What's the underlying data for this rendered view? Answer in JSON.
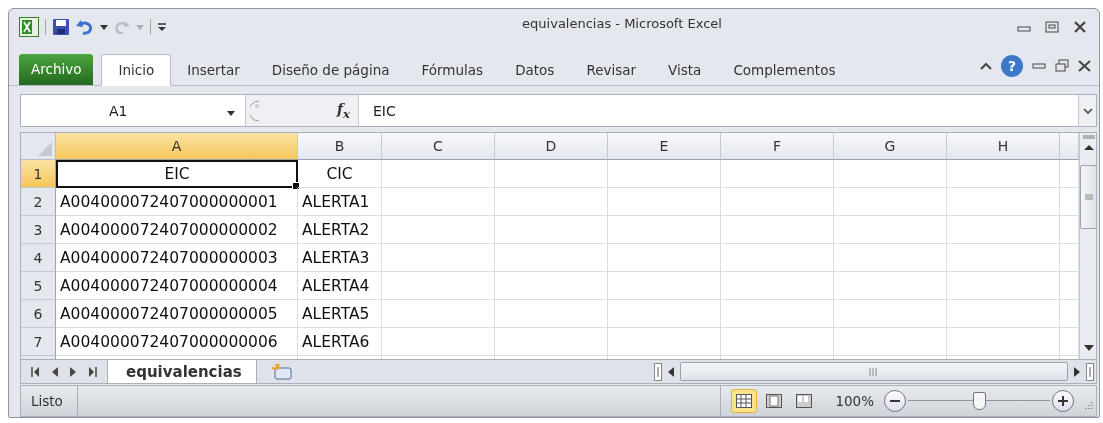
{
  "window": {
    "title": "equivalencias - Microsoft Excel"
  },
  "ribbon_tabs": [
    {
      "label": "Archivo",
      "kind": "file",
      "selected": false
    },
    {
      "label": "Inicio",
      "kind": "tab",
      "selected": true
    },
    {
      "label": "Insertar",
      "kind": "tab",
      "selected": false
    },
    {
      "label": "Diseño de página",
      "kind": "tab",
      "selected": false
    },
    {
      "label": "Fórmulas",
      "kind": "tab",
      "selected": false
    },
    {
      "label": "Datos",
      "kind": "tab",
      "selected": false
    },
    {
      "label": "Revisar",
      "kind": "tab",
      "selected": false
    },
    {
      "label": "Vista",
      "kind": "tab",
      "selected": false
    },
    {
      "label": "Complementos",
      "kind": "tab",
      "selected": false
    }
  ],
  "help_button": "?",
  "formula_bar": {
    "name_box": "A1",
    "function_label": "f$_{x}$",
    "formula": "EIC"
  },
  "columns": [
    {
      "label": "A",
      "selected": true
    },
    {
      "label": "B",
      "selected": false
    },
    {
      "label": "C",
      "selected": false
    },
    {
      "label": "D",
      "selected": false
    },
    {
      "label": "E",
      "selected": false
    },
    {
      "label": "F",
      "selected": false
    },
    {
      "label": "G",
      "selected": false
    },
    {
      "label": "H",
      "selected": false
    }
  ],
  "rows": [
    {
      "number": "1",
      "kind": "heading",
      "selected": true,
      "cells": [
        "EIC",
        "CIC"
      ]
    },
    {
      "number": "2",
      "kind": "data",
      "selected": false,
      "cells": [
        "A004000072407000000001",
        "ALERTA1"
      ]
    },
    {
      "number": "3",
      "kind": "data",
      "selected": false,
      "cells": [
        "A004000072407000000002",
        "ALERTA2"
      ]
    },
    {
      "number": "4",
      "kind": "data",
      "selected": false,
      "cells": [
        "A004000072407000000003",
        "ALERTA3"
      ]
    },
    {
      "number": "5",
      "kind": "data",
      "selected": false,
      "cells": [
        "A004000072407000000004",
        "ALERTA4"
      ]
    },
    {
      "number": "6",
      "kind": "data",
      "selected": false,
      "cells": [
        "A004000072407000000005",
        "ALERTA5"
      ]
    },
    {
      "number": "7",
      "kind": "data",
      "selected": false,
      "cells": [
        "A004000072407000000006",
        "ALERTA6"
      ]
    }
  ],
  "sheet_tabs": [
    {
      "label": "equivalencias",
      "selected": true
    }
  ],
  "status_bar": {
    "status": "Listo",
    "views": [
      {
        "kind": "normal",
        "selected": true
      },
      {
        "kind": "page-layout",
        "selected": false
      },
      {
        "kind": "page-break",
        "selected": false
      }
    ],
    "zoom": {
      "label": "100%",
      "level": 0.5
    }
  }
}
